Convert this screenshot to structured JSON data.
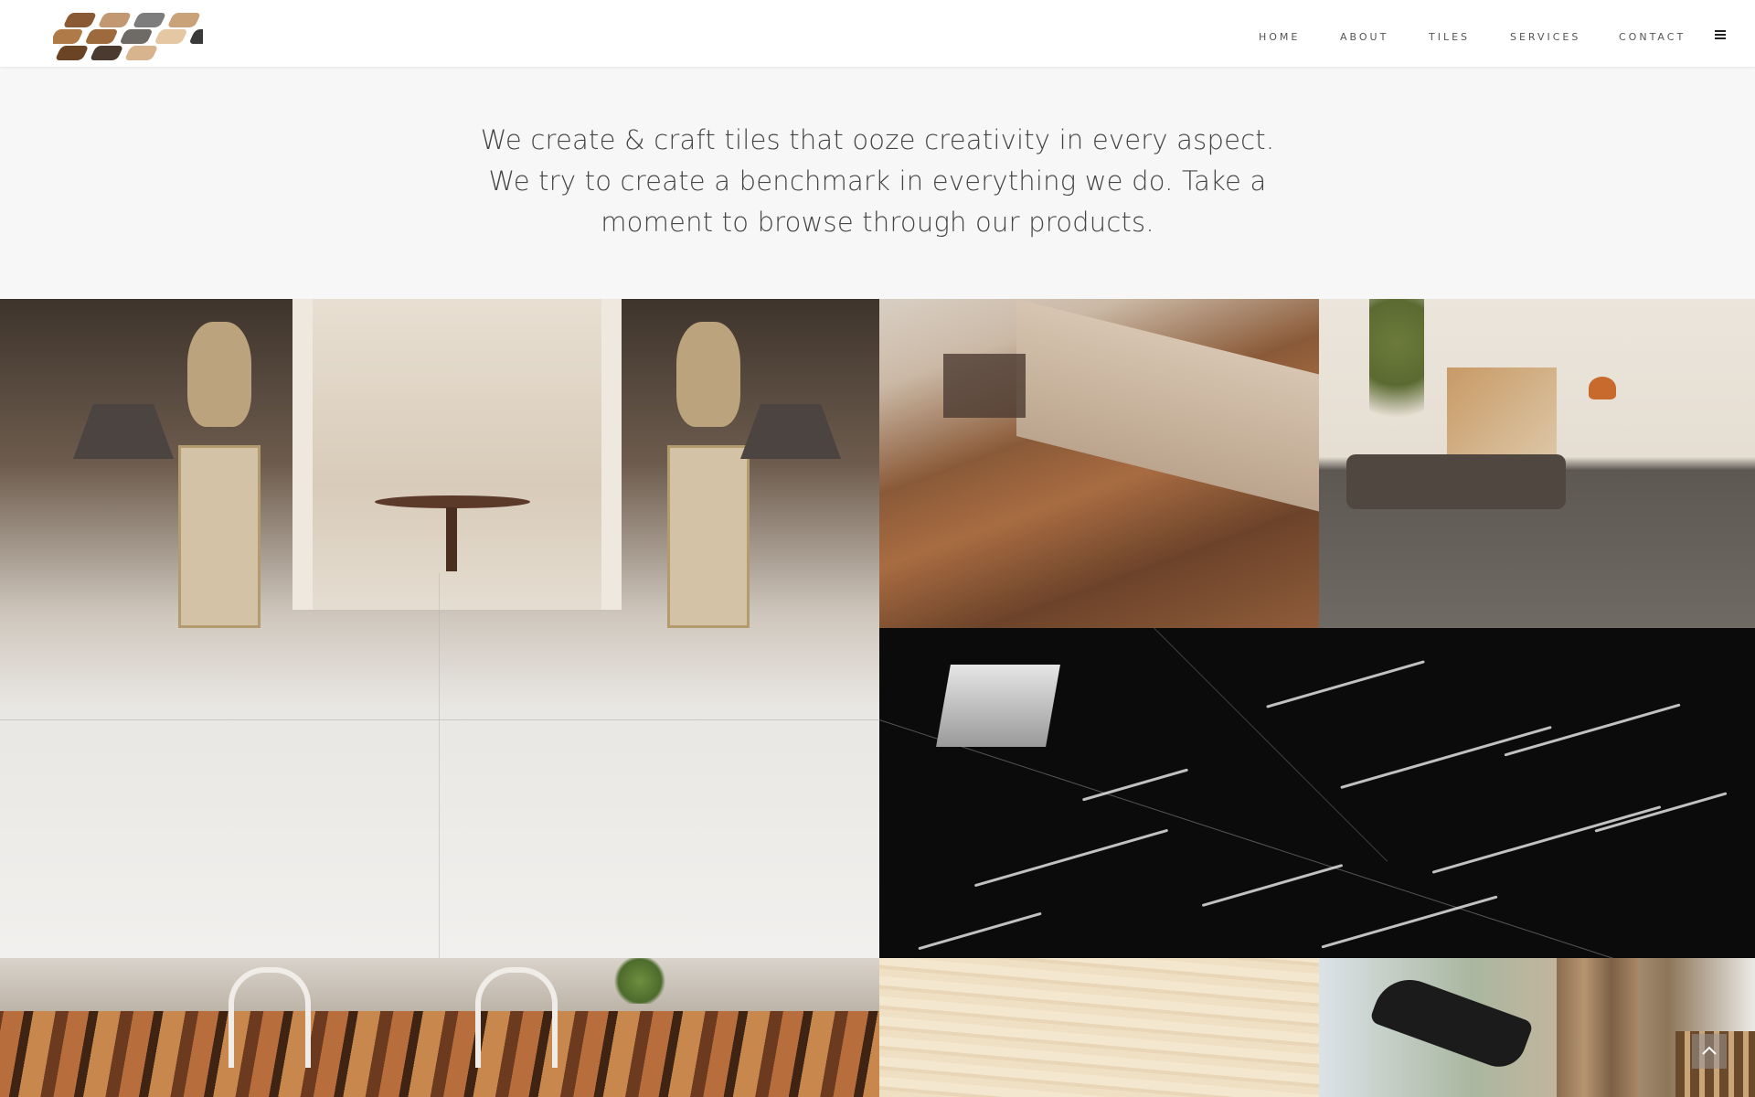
{
  "nav": {
    "items": [
      {
        "label": "HOME"
      },
      {
        "label": "ABOUT"
      },
      {
        "label": "TILES"
      },
      {
        "label": "SERVICES"
      },
      {
        "label": "CONTACT"
      }
    ],
    "menu_icon": "hamburger-menu-icon"
  },
  "intro": {
    "text": "We create & craft tiles that ooze creativity in every aspect. We try to create a benchmark in everything we do. Take a moment to browse through our products."
  },
  "gallery": {
    "tiles": [
      {
        "name": "white-onyx-hallway"
      },
      {
        "name": "wood-finish-living-room"
      },
      {
        "name": "grey-marble-lounge"
      },
      {
        "name": "black-marble-floor"
      },
      {
        "name": "striped-wood-dining"
      },
      {
        "name": "travertine-beige"
      },
      {
        "name": "lounge-chair-room"
      }
    ]
  },
  "scroll_top": {
    "icon": "chevron-up-icon"
  },
  "colors": {
    "header_bg": "#ffffff",
    "intro_bg": "#f7f7f7",
    "text": "#444444"
  }
}
